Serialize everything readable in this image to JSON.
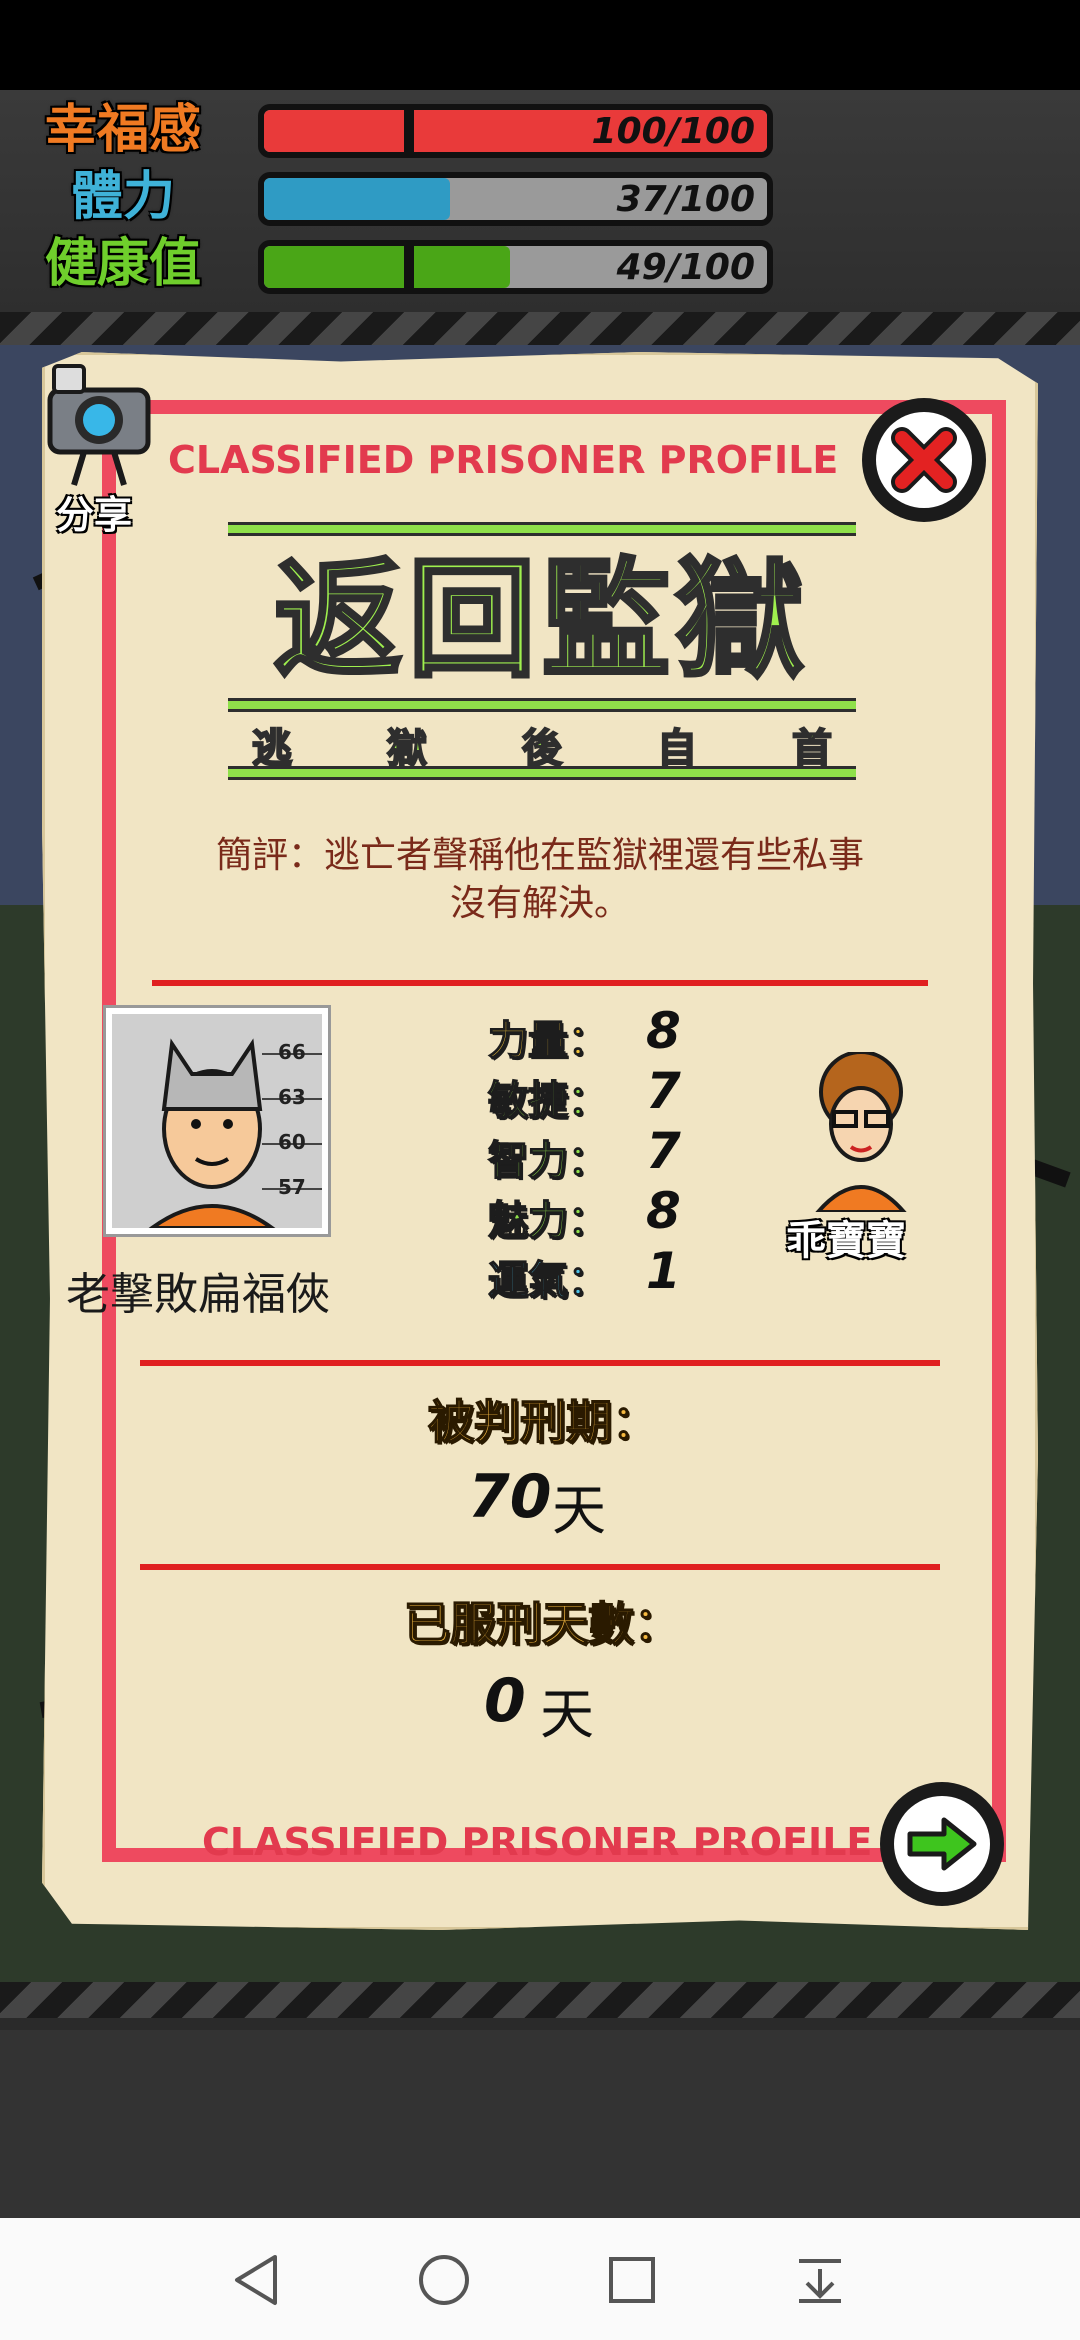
{
  "hud": {
    "happiness": {
      "label": "幸福感",
      "value_text": "100/100",
      "fill_fraction": 1.0,
      "color": "#e93a3a"
    },
    "stamina": {
      "label": "體力",
      "value_text": "37/100",
      "fill_fraction": 0.37,
      "color": "#2f9bc4"
    },
    "health": {
      "label": "健康值",
      "value_text": "49/100",
      "fill_fraction": 0.49,
      "color": "#4aa617"
    }
  },
  "share": {
    "label": "分享",
    "icon": "camera-icon"
  },
  "profile": {
    "classified_top": "CLASSIFIED PRISONER PROFILE",
    "classified_bottom": "CLASSIFIED PRISONER PROFILE",
    "title": "返回監獄",
    "subtitle": [
      "逃",
      "獄",
      "後",
      "自",
      "首"
    ],
    "description_line1": "簡評：逃亡者聲稱他在監獄裡還有些私事",
    "description_line2": "沒有解決。",
    "prisoner_name": "老撃敗扁福俠",
    "mugshot_heights": [
      "66",
      "63",
      "60",
      "57"
    ],
    "attributes": [
      {
        "label": "力量：",
        "value": "8",
        "color": "#f0c23a"
      },
      {
        "label": "敏捷：",
        "value": "7",
        "color": "#8fe04a"
      },
      {
        "label": "智力：",
        "value": "7",
        "color": "#8fe04a"
      },
      {
        "label": "魅力：",
        "value": "8",
        "color": "#8fe04a"
      },
      {
        "label": "運氣：",
        "value": "1",
        "color": "#4cc3e8"
      }
    ],
    "character_tag": "乖寶寶",
    "sentence_label": "被判刑期：",
    "sentence_value": "70",
    "sentence_unit": "天",
    "served_label": "已服刑天數：",
    "served_value": "0",
    "served_unit": "天"
  },
  "buttons": {
    "close": "close-icon",
    "next": "arrow-right-icon"
  },
  "navbar": {
    "back": "back-icon",
    "home": "home-icon",
    "recents": "recents-icon",
    "menu": "download-icon"
  }
}
